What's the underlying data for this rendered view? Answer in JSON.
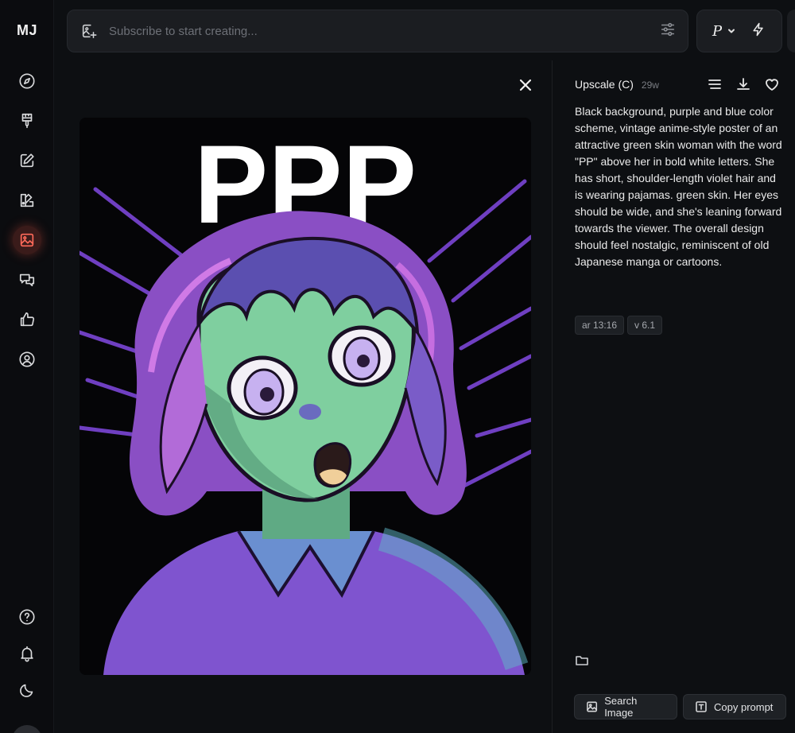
{
  "app": {
    "logo": "MJ"
  },
  "sidebar": {
    "items": [
      {
        "name": "explore",
        "icon": "compass-icon"
      },
      {
        "name": "create",
        "icon": "paintbrush-icon"
      },
      {
        "name": "edit",
        "icon": "pencil-square-icon"
      },
      {
        "name": "personalize",
        "icon": "palette-icon"
      },
      {
        "name": "organize",
        "icon": "image-icon",
        "active": true
      },
      {
        "name": "chat",
        "icon": "chat-bubbles-icon"
      },
      {
        "name": "rank",
        "icon": "thumbs-up-icon"
      },
      {
        "name": "profile",
        "icon": "user-circle-icon"
      }
    ],
    "bottom": [
      {
        "name": "help",
        "icon": "question-circle-icon"
      },
      {
        "name": "notifications",
        "icon": "bell-icon"
      },
      {
        "name": "theme",
        "icon": "moon-icon"
      },
      {
        "name": "account",
        "icon": "avatar-icon"
      }
    ],
    "active_color": "#ff6a5a"
  },
  "topbar": {
    "search_placeholder": "Subscribe to start creating...",
    "search_value": "",
    "mode_label": "P"
  },
  "image": {
    "title_text": "PPP",
    "palette": {
      "background": "#050507",
      "purple": "#8a5ad6",
      "violet": "#b26bd8",
      "green_skin": "#7fcf9f",
      "lavender": "#c7b1f0"
    }
  },
  "panel": {
    "title": "Upscale (C)",
    "age": "29w",
    "prompt": "Black background, purple and blue color scheme, vintage anime-style poster of an attractive green skin woman with the word \"PP\" above her in bold white letters. She has short, shoulder-length violet hair and is wearing pajamas. green skin. Her eyes should be wide, and she's leaning forward towards the viewer. The overall design should feel nostalgic, reminiscent of old Japanese manga or cartoons.",
    "tags": [
      "ar 13:16",
      "v 6.1"
    ],
    "buttons": {
      "search_image": "Search Image",
      "copy_prompt": "Copy prompt"
    }
  }
}
